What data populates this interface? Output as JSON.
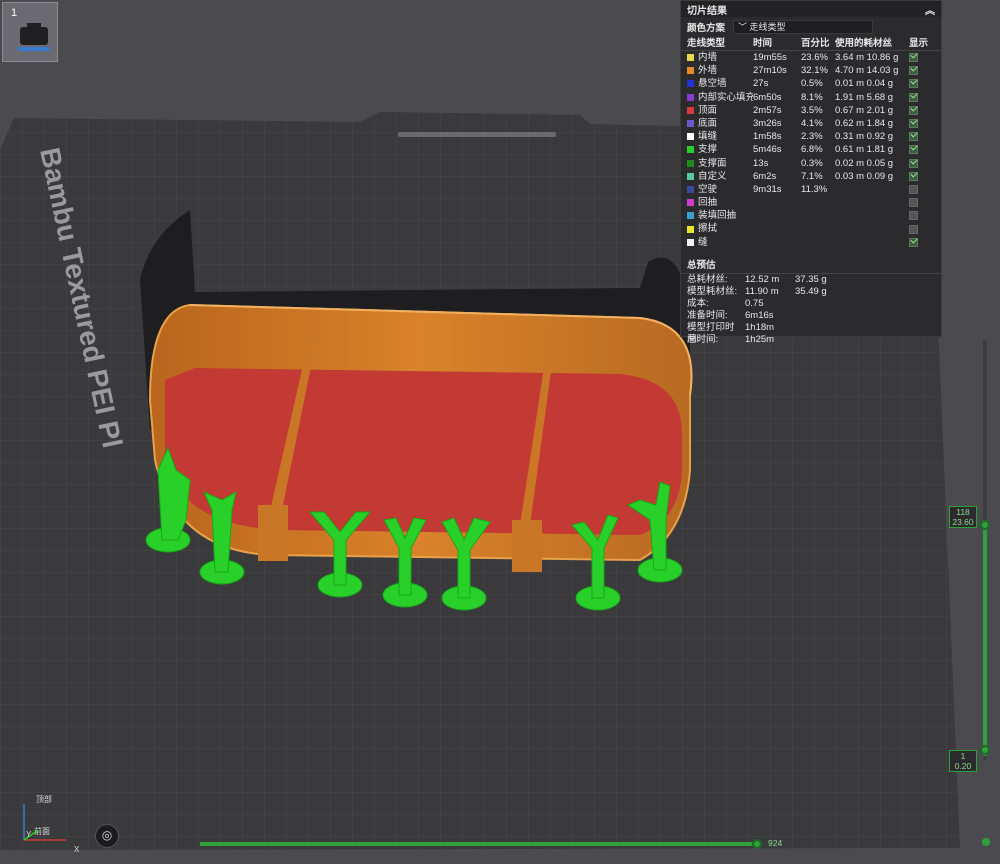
{
  "thumbnail": {
    "plate_number": "1"
  },
  "plate": {
    "brand_text": "Bambu Textured PEI Pl"
  },
  "panel": {
    "title": "切片结果",
    "color_scheme_label": "颜色方案",
    "color_scheme_value": "走线类型",
    "headers": {
      "type": "走线类型",
      "time": "时间",
      "percent": "百分比",
      "filament": "使用的耗材丝",
      "show": "显示"
    },
    "rows": [
      {
        "name": "内墙",
        "color": "#e8d84a",
        "time": "19m55s",
        "percent": "23.6%",
        "filament": "3.64 m  10.86 g",
        "shown": true
      },
      {
        "name": "外墙",
        "color": "#e88a2a",
        "time": "27m10s",
        "percent": "32.1%",
        "filament": "4.70 m  14.03 g",
        "shown": true
      },
      {
        "name": "悬空墙",
        "color": "#2433d6",
        "time": "27s",
        "percent": "0.5%",
        "filament": "0.01 m  0.04 g",
        "shown": true
      },
      {
        "name": "内部实心填充",
        "color": "#8a3ad0",
        "time": "6m50s",
        "percent": "8.1%",
        "filament": "1.91 m  5.68 g",
        "shown": true
      },
      {
        "name": "顶面",
        "color": "#d63a3a",
        "time": "2m57s",
        "percent": "3.5%",
        "filament": "0.67 m  2.01 g",
        "shown": true
      },
      {
        "name": "底面",
        "color": "#6a5ad0",
        "time": "3m26s",
        "percent": "4.1%",
        "filament": "0.62 m  1.84 g",
        "shown": true
      },
      {
        "name": "填缝",
        "color": "#ffffff",
        "time": "1m58s",
        "percent": "2.3%",
        "filament": "0.31 m  0.92 g",
        "shown": true
      },
      {
        "name": "支撑",
        "color": "#2ad02a",
        "time": "5m46s",
        "percent": "6.8%",
        "filament": "0.61 m  1.81 g",
        "shown": true
      },
      {
        "name": "支撑面",
        "color": "#1e8a1e",
        "time": "13s",
        "percent": "0.3%",
        "filament": "0.02 m  0.05 g",
        "shown": true
      },
      {
        "name": "自定义",
        "color": "#5ac89a",
        "time": "6m2s",
        "percent": "7.1%",
        "filament": "0.03 m  0.09 g",
        "shown": true
      },
      {
        "name": "空驶",
        "color": "#3a4aa0",
        "time": "9m31s",
        "percent": "11.3%",
        "filament": "",
        "shown": false
      },
      {
        "name": "回抽",
        "color": "#d03ad0",
        "time": "",
        "percent": "",
        "filament": "",
        "shown": false
      },
      {
        "name": "装填回抽",
        "color": "#3aa0d0",
        "time": "",
        "percent": "",
        "filament": "",
        "shown": false
      },
      {
        "name": "擦拭",
        "color": "#e8e82a",
        "time": "",
        "percent": "",
        "filament": "",
        "shown": false
      },
      {
        "name": "缝",
        "color": "#f0f0f0",
        "time": "",
        "percent": "",
        "filament": "",
        "shown": true
      }
    ],
    "estimate_title": "总预估",
    "estimates": [
      {
        "label": "总耗材丝:",
        "v1": "12.52 m",
        "v2": "37.35 g"
      },
      {
        "label": "模型耗材丝:",
        "v1": "11.90 m",
        "v2": "35.49 g"
      },
      {
        "label": "成本:",
        "v1": "0.75",
        "v2": ""
      },
      {
        "label": "准备时间:",
        "v1": "6m16s",
        "v2": ""
      },
      {
        "label": "模型打印时间:",
        "v1": "1h18m",
        "v2": ""
      },
      {
        "label": "总时间:",
        "v1": "1h25m",
        "v2": ""
      }
    ]
  },
  "layer_slider": {
    "top_layer": "118",
    "top_height": "23.60",
    "bottom_layer": "1",
    "bottom_height": "0.20"
  },
  "move_slider": {
    "value": "924"
  },
  "view_cube": {
    "top": "顶部",
    "front": "前面"
  },
  "axes": {
    "x": "X",
    "y": "Y"
  }
}
